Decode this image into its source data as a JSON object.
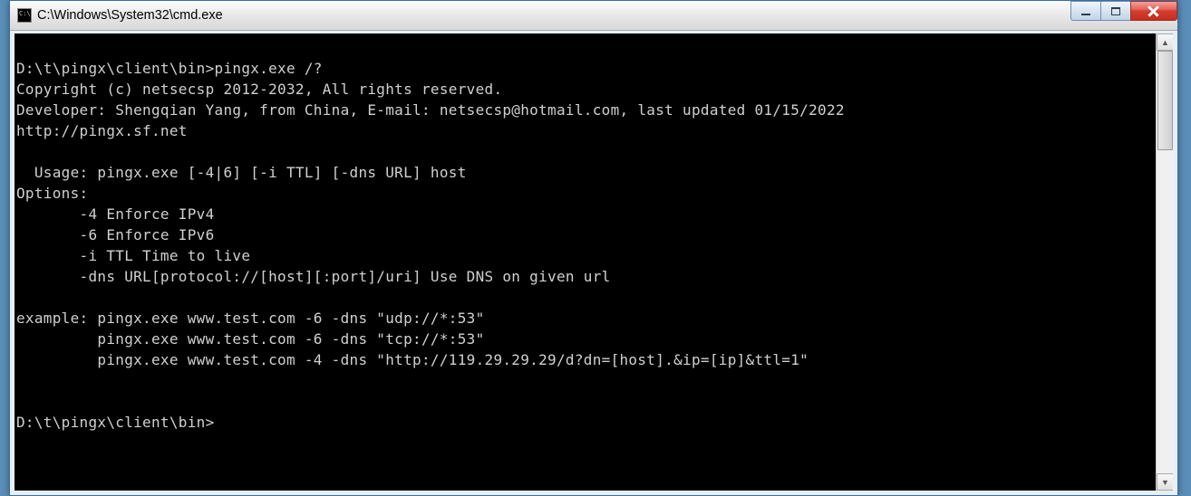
{
  "window": {
    "title": "C:\\Windows\\System32\\cmd.exe"
  },
  "terminal": {
    "lines": [
      "",
      "D:\\t\\pingx\\client\\bin>pingx.exe /?",
      "Copyright (c) netsecsp 2012-2032, All rights reserved.",
      "Developer: Shengqian Yang, from China, E-mail: netsecsp@hotmail.com, last updated 01/15/2022",
      "http://pingx.sf.net",
      "",
      "  Usage: pingx.exe [-4|6] [-i TTL] [-dns URL] host",
      "Options:",
      "       -4 Enforce IPv4",
      "       -6 Enforce IPv6",
      "       -i TTL Time to live",
      "       -dns URL[protocol://[host][:port]/uri] Use DNS on given url",
      "",
      "example: pingx.exe www.test.com -6 -dns \"udp://*:53\"",
      "         pingx.exe www.test.com -6 -dns \"tcp://*:53\"",
      "         pingx.exe www.test.com -4 -dns \"http://119.29.29.29/d?dn=[host].&ip=[ip]&ttl=1\"",
      "",
      "",
      "D:\\t\\pingx\\client\\bin>"
    ]
  },
  "scroll": {
    "up_glyph": "▲",
    "down_glyph": "▼"
  }
}
